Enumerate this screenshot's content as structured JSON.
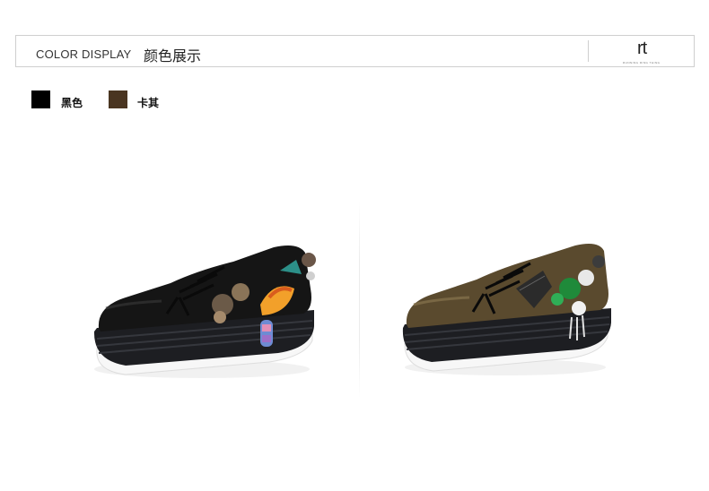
{
  "header": {
    "title_en": "COLOR DISPLAY",
    "title_cn": "颜色展示",
    "logo_mark": "rt",
    "logo_tagline": "RUNNING RING THING"
  },
  "swatches": [
    {
      "label": "黑色",
      "color": "#000000"
    },
    {
      "label": "卡其",
      "color": "#4a3521"
    }
  ],
  "products": [
    {
      "variant": "black",
      "upper_color": "#151515"
    },
    {
      "variant": "khaki",
      "upper_color": "#5a4a2e"
    }
  ]
}
